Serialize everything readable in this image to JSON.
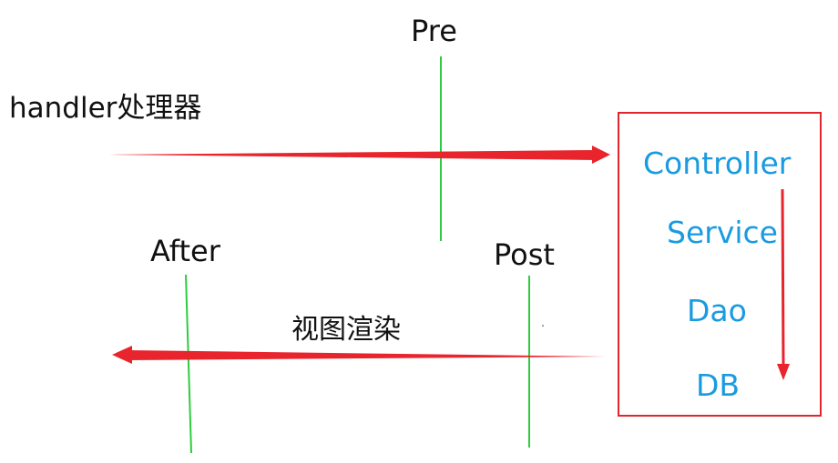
{
  "labels": {
    "pre": "Pre",
    "post": "Post",
    "after": "After",
    "handler": "handler处理器",
    "render": "视图渲染"
  },
  "box": {
    "items": [
      "Controller",
      "Service",
      "Dao",
      "DB"
    ]
  },
  "colors": {
    "arrow": "#e8242c",
    "box_border": "#e0262c",
    "interceptor_line": "#2ecc40",
    "box_text": "#1a9be0",
    "text": "#111111"
  }
}
